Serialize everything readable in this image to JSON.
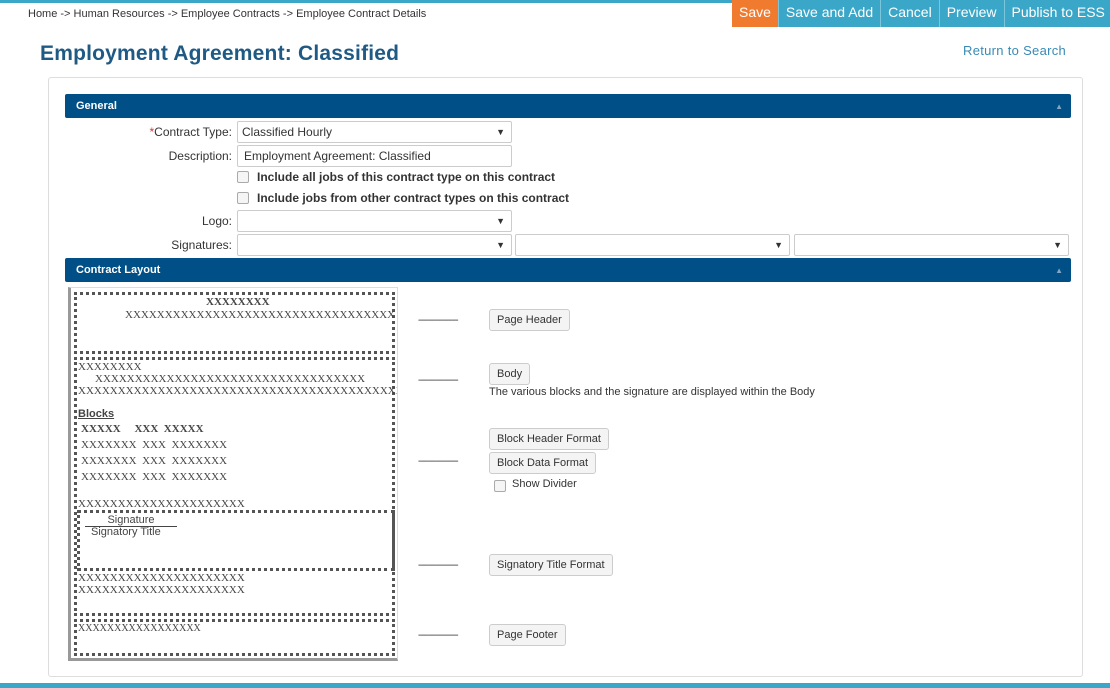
{
  "breadcrumb": "Home -> Human Resources -> Employee Contracts -> Employee Contract Details",
  "toolbar": {
    "save": "Save",
    "save_add": "Save and Add",
    "cancel": "Cancel",
    "preview": "Preview",
    "publish": "Publish to ESS"
  },
  "page_title": "Employment Agreement: Classified",
  "return_link": "Return to Search",
  "colors": {
    "accent": "#3aa6c8",
    "save": "#f07b2f",
    "section_header": "#004f86",
    "title": "#1f5a85"
  },
  "general": {
    "header": "General",
    "contract_type_label": "Contract Type:",
    "required_marker": "*",
    "contract_type_value": "Classified Hourly",
    "description_label": "Description:",
    "description_value": "Employment Agreement: Classified",
    "include_all_jobs": "Include all jobs of this contract type on this contract",
    "include_other_types": "Include jobs from other contract types on this contract",
    "logo_label": "Logo:",
    "signatures_label": "Signatures:"
  },
  "layout": {
    "header": "Contract Layout",
    "preview": {
      "header_line1": "XXXXXXXX",
      "header_line2": "XXXXXXXXXXXXXXXXXXXXXXXXXXXXXXXXXX",
      "body_line1": "XXXXXXXX",
      "body_line2": "XXXXXXXXXXXXXXXXXXXXXXXXXXXXXXXXXX",
      "body_line3": "XXXXXXXXXXXXXXXXXXXXXXXXXXXXXXXXXXXXXXXXXXXXXXXX",
      "blocks_title": "Blocks",
      "block_head": "XXXXX     XXX  XXXXX",
      "block_row": "XXXXXXX  XXX  XXXXXXX",
      "after_blocks": "XXXXXXXXXXXXXXXXXXXXX",
      "signature": "Signature",
      "signatory_title": "Signatory Title",
      "after_sig": "XXXXXXXXXXXXXXXXXXXXX",
      "footer_line": "XXXXXXXXXXXXXXXXX"
    },
    "page_header_btn": "Page Header",
    "body_btn": "Body",
    "body_note": "The various blocks and the signature are displayed within the Body",
    "block_header_btn": "Block Header Format",
    "block_data_btn": "Block Data Format",
    "show_divider": "Show Divider",
    "signatory_btn": "Signatory Title Format",
    "page_footer_btn": "Page Footer",
    "dash": "-----------------"
  }
}
